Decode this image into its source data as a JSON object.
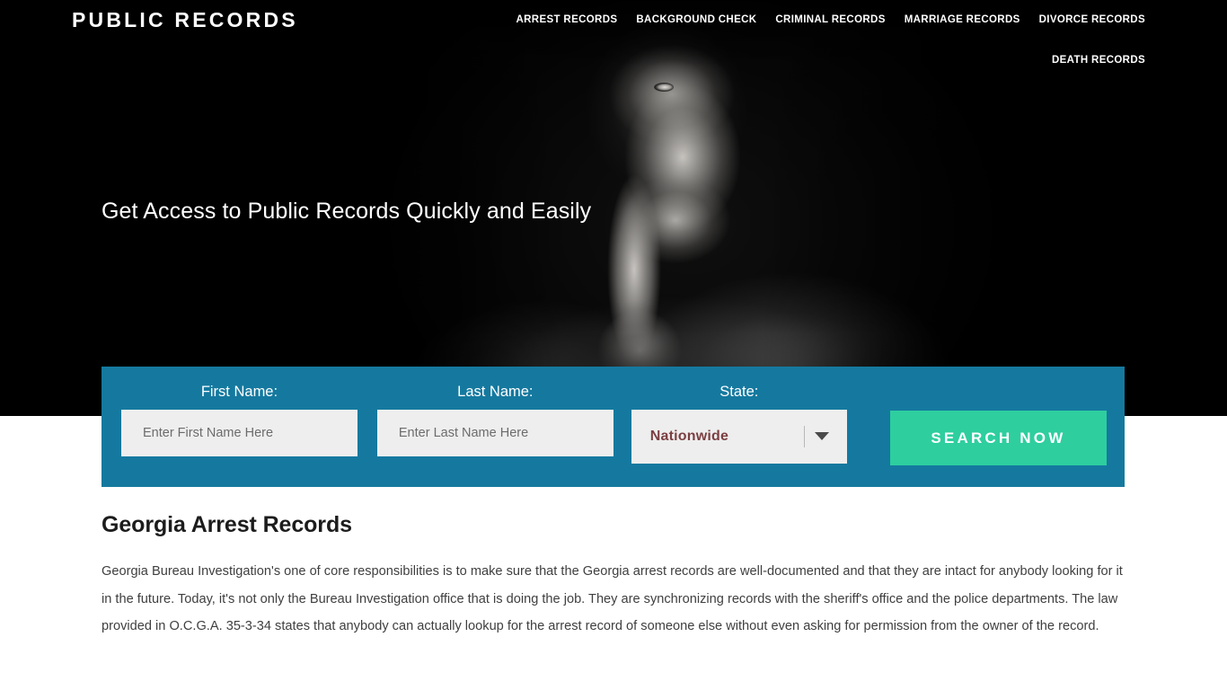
{
  "header": {
    "brand": "PUBLIC RECORDS",
    "nav": [
      "ARREST RECORDS",
      "BACKGROUND CHECK",
      "CRIMINAL RECORDS",
      "MARRIAGE RECORDS",
      "DIVORCE RECORDS",
      "DEATH RECORDS"
    ]
  },
  "hero": {
    "headline": "Get Access to Public Records Quickly and Easily",
    "image_alt": "black-and-white photo of a man with his index finger to his lips"
  },
  "search": {
    "first_name": {
      "label": "First Name:",
      "placeholder": "Enter First Name Here",
      "value": ""
    },
    "last_name": {
      "label": "Last Name:",
      "placeholder": "Enter Last Name Here",
      "value": ""
    },
    "state": {
      "label": "State:",
      "selected": "Nationwide",
      "dropdown_icon": "chevron-down-icon"
    },
    "submit_label": "SEARCH NOW"
  },
  "article": {
    "title": "Georgia Arrest Records",
    "body": "Georgia Bureau Investigation's one of core responsibilities is to make sure that the Georgia arrest records are well-documented and that they are intact for anybody looking for it in the future. Today, it's not only the Bureau Investigation office that is doing the job. They are synchronizing records with the sheriff's office and the police departments. The law provided in O.C.G.A. 35-3-34 states that anybody can actually lookup for the arrest record of someone else without even asking for permission from the owner of the record."
  },
  "colors": {
    "panel_blue": "#15799f",
    "button_green": "#2ece9f",
    "select_text": "#7b3f41",
    "hero_background": "#000000"
  }
}
